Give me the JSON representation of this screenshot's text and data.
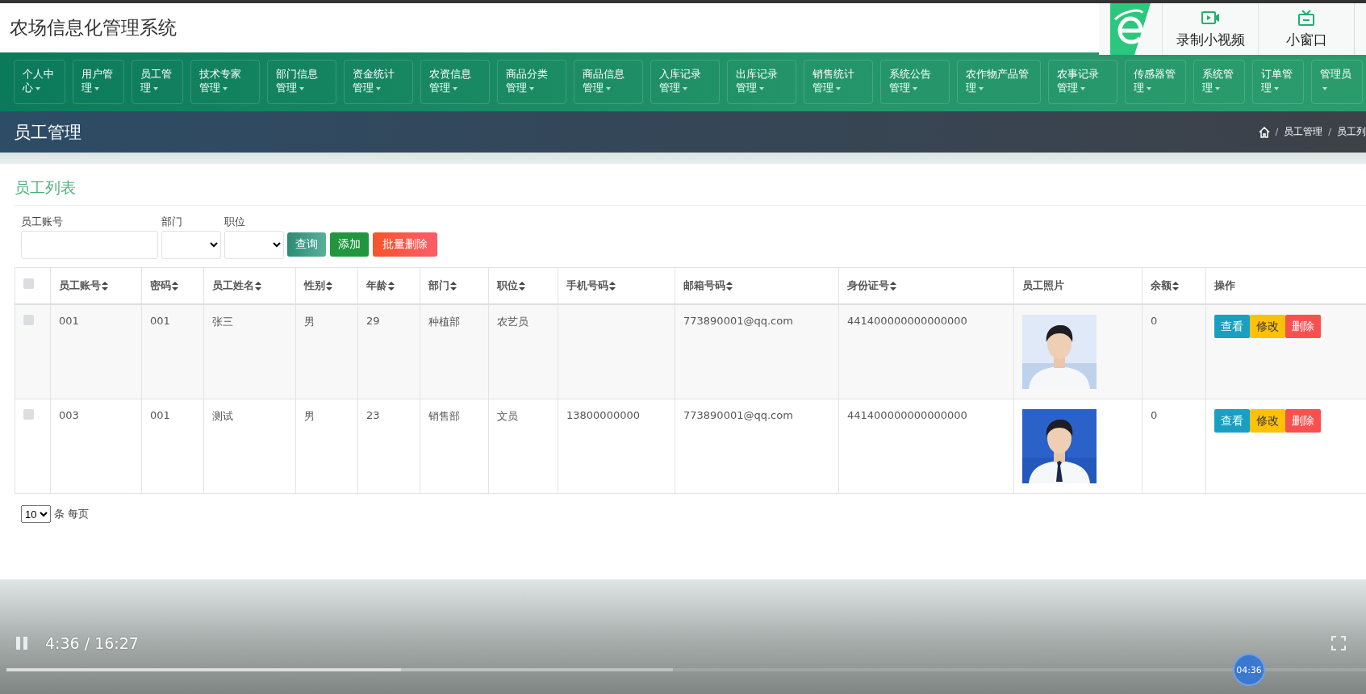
{
  "header": {
    "title": "农场信息化管理系统"
  },
  "browser_overlay": {
    "buttons": [
      {
        "kind": "record",
        "label": "录制小视频"
      },
      {
        "kind": "mini",
        "label": "小窗口"
      }
    ]
  },
  "nav": {
    "items": [
      {
        "label": "个人中心"
      },
      {
        "label": "用户管理"
      },
      {
        "label": "员工管理"
      },
      {
        "label": "技术专家管理"
      },
      {
        "label": "部门信息管理"
      },
      {
        "label": "资金统计管理"
      },
      {
        "label": "农资信息管理"
      },
      {
        "label": "商品分类管理"
      },
      {
        "label": "商品信息管理"
      },
      {
        "label": "入库记录管理"
      },
      {
        "label": "出库记录管理"
      },
      {
        "label": "销售统计管理"
      },
      {
        "label": "系统公告管理"
      },
      {
        "label": "农作物产品管理"
      },
      {
        "label": "农事记录管理"
      },
      {
        "label": "传感器管理"
      },
      {
        "label": "系统管理"
      },
      {
        "label": "订单管理"
      },
      {
        "label": "管理员"
      }
    ]
  },
  "page_header": {
    "title": "员工管理",
    "breadcrumb": [
      {
        "kind": "separator",
        "text": "/"
      },
      {
        "kind": "link",
        "text": "员工管理"
      },
      {
        "kind": "separator",
        "text": "/"
      },
      {
        "kind": "link",
        "text": "员工列"
      }
    ]
  },
  "card": {
    "title": "员工列表",
    "filters": [
      {
        "kind": "text",
        "label": "员工账号"
      },
      {
        "kind": "select",
        "label": "部门"
      },
      {
        "kind": "select",
        "label": "职位"
      }
    ],
    "buttons": [
      {
        "kind": "query",
        "label": "查询"
      },
      {
        "kind": "add",
        "label": "添加"
      },
      {
        "kind": "batch_delete",
        "label": "批量删除"
      }
    ],
    "table": {
      "select_all": {
        "checked": false
      },
      "columns": [
        {
          "label": "员工账号",
          "sortable": true
        },
        {
          "label": "密码",
          "sortable": true
        },
        {
          "label": "员工姓名",
          "sortable": true
        },
        {
          "label": "性别",
          "sortable": true
        },
        {
          "label": "年龄",
          "sortable": true
        },
        {
          "label": "部门",
          "sortable": true
        },
        {
          "label": "职位",
          "sortable": true
        },
        {
          "label": "手机号码",
          "sortable": true
        },
        {
          "label": "邮箱号码",
          "sortable": true
        },
        {
          "label": "身份证号",
          "sortable": true
        },
        {
          "label": "员工照片",
          "sortable": false
        },
        {
          "label": "余额",
          "sortable": true
        },
        {
          "label": "操作",
          "sortable": false
        }
      ],
      "rows": [
        {
          "checked": false,
          "cells": [
            "001",
            "001",
            "张三",
            "男",
            "29",
            "种植部",
            "农艺员",
            null,
            "773890001@qq.com",
            "441400000000000000",
            {
              "kind": "picture"
            },
            "0"
          ],
          "actions": [
            {
              "kind": "view",
              "label": "查看"
            },
            {
              "kind": "edit",
              "label": "修改"
            },
            {
              "kind": "delete",
              "label": "删除"
            }
          ]
        },
        {
          "checked": false,
          "cells": [
            "003",
            "001",
            "测试",
            "男",
            "23",
            "销售部",
            "文员",
            "13800000000",
            "773890001@qq.com",
            "441400000000000000",
            {
              "kind": "picture"
            },
            "0"
          ],
          "actions": [
            {
              "kind": "view",
              "label": "查看"
            },
            {
              "kind": "edit",
              "label": "修改"
            },
            {
              "kind": "delete",
              "label": "删除"
            }
          ]
        }
      ]
    },
    "pagination": {
      "page_size": "10",
      "suffix": "条 每页"
    }
  },
  "player": {
    "time": "4:36 / 16:27",
    "progress": {
      "level": 0.29
    },
    "buffered": {
      "level": 0.49
    },
    "bubble": "04:36"
  }
}
